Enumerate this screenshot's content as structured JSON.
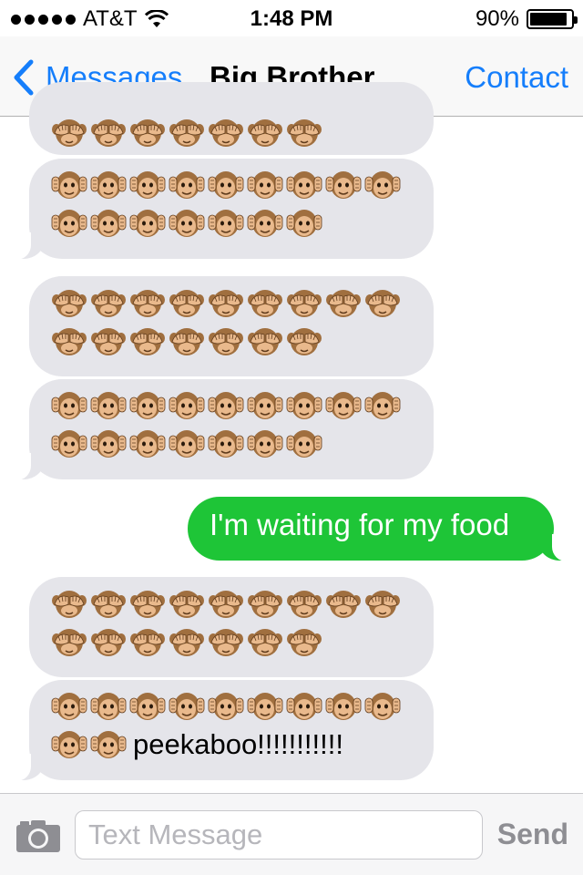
{
  "status_bar": {
    "carrier": "AT&T",
    "time": "1:48 PM",
    "battery_text": "90%",
    "battery_level": 0.9
  },
  "nav": {
    "back_label": "Messages",
    "title": "Big Brother",
    "action_label": "Contact"
  },
  "messages": [
    {
      "from": "them",
      "emoji": [
        {
          "icon": "see-no-evil-monkey",
          "count": 7
        }
      ]
    },
    {
      "from": "them",
      "emoji": [
        {
          "icon": "hear-no-evil-monkey",
          "count": 16
        }
      ]
    },
    {
      "from": "them",
      "emoji": [
        {
          "icon": "see-no-evil-monkey",
          "count": 16
        }
      ]
    },
    {
      "from": "them",
      "emoji": [
        {
          "icon": "hear-no-evil-monkey",
          "count": 16
        }
      ]
    },
    {
      "from": "me",
      "text": "I'm waiting for my food"
    },
    {
      "from": "them",
      "emoji": [
        {
          "icon": "see-no-evil-monkey",
          "count": 16
        }
      ]
    },
    {
      "from": "them",
      "emoji": [
        {
          "icon": "hear-no-evil-monkey",
          "count": 11
        }
      ],
      "text": "peekaboo!!!!!!!!!!!"
    }
  ],
  "input": {
    "placeholder": "Text Message",
    "send_label": "Send"
  },
  "colors": {
    "ios_blue": "#157efb",
    "outgoing_bubble": "#1ec537",
    "incoming_bubble": "#e5e5ea"
  }
}
